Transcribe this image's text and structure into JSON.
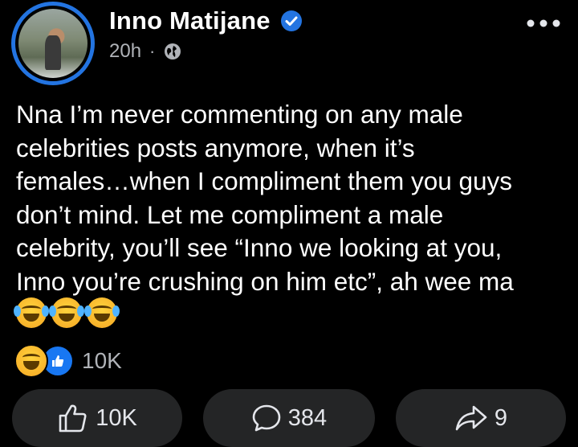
{
  "author": {
    "name": "Inno Matijane",
    "time": "20h",
    "separator": "·"
  },
  "post": {
    "text": "Nna I’m never commenting on any male\ncelebrities posts anymore, when it’s\nfemales…when I compliment them you guys\ndon’t mind. Let me compliment a male\ncelebrity, you’ll see “Inno we looking at you,\nInno you’re crushing on him etc”, ah wee ma",
    "emojis": [
      "face-with-tears-of-joy",
      "face-with-tears-of-joy",
      "face-with-tears-of-joy"
    ]
  },
  "reactions": {
    "icons": [
      "haha-icon",
      "like-icon"
    ],
    "count": "10K"
  },
  "actions": {
    "like_count": "10K",
    "comment_count": "384",
    "share_count": "9"
  },
  "colors": {
    "background": "#000000",
    "verified": "#2374e1",
    "secondary_text": "#b0b3b8",
    "button_bg": "#242526",
    "like_blue": "#1877f2"
  }
}
